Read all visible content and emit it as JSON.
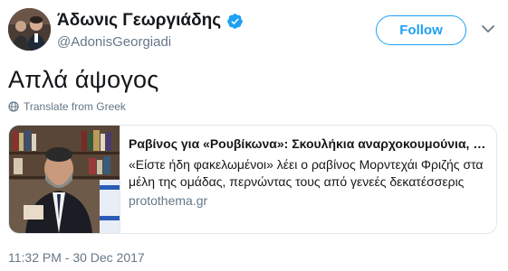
{
  "author": {
    "name": "Άδωνις Γεωργιάδης",
    "handle": "@AdonisGeorgiadi",
    "verified": true
  },
  "actions": {
    "follow_label": "Follow"
  },
  "tweet": {
    "text": "Απλά άψογος",
    "translate_label": "Translate from Greek",
    "timestamp": "11:32 PM - 30 Dec 2017"
  },
  "card": {
    "title": "Ραβίνος για «Ρουβίκωνα»: Σκουλήκια αναρχοκουμούνια, σ...",
    "description": "«Είστε ήδη φακελωμένοι» λέει ο ραβίνος Μορντεχάι Φριζής στα μέλη της ομάδας, περνώντας τους από γενεές δεκατέσσερις",
    "domain": "protothema.gr"
  },
  "colors": {
    "accent": "#1da1f2",
    "secondary_text": "#657786",
    "primary_text": "#14171a",
    "border": "#e1e8ed"
  },
  "icons": {
    "verified": "verified-badge-icon",
    "more": "chevron-down-icon",
    "translate": "globe-icon"
  }
}
